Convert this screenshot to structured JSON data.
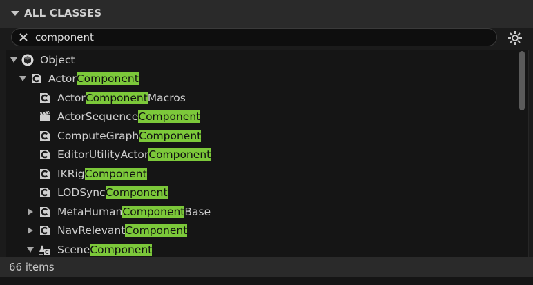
{
  "header": {
    "title": "ALL CLASSES"
  },
  "search": {
    "value": "component"
  },
  "tree": {
    "root": {
      "label": "Object"
    },
    "rows": [
      {
        "pre": "Actor",
        "hl": "Component",
        "post": ""
      },
      {
        "pre": "Actor",
        "hl": "Component",
        "post": "Macros"
      },
      {
        "pre": "ActorSequence",
        "hl": "Component",
        "post": ""
      },
      {
        "pre": "ComputeGraph",
        "hl": "Component",
        "post": ""
      },
      {
        "pre": "EditorUtilityActor",
        "hl": "Component",
        "post": ""
      },
      {
        "pre": "IKRig",
        "hl": "Component",
        "post": ""
      },
      {
        "pre": "LODSync",
        "hl": "Component",
        "post": ""
      },
      {
        "pre": "MetaHuman",
        "hl": "Component",
        "post": "Base"
      },
      {
        "pre": "NavRelevant",
        "hl": "Component",
        "post": ""
      },
      {
        "pre": "Scene",
        "hl": "Component",
        "post": ""
      }
    ]
  },
  "footer": {
    "count": "66 items"
  },
  "icons": {
    "collapse": "caret-down-icon",
    "clear": "x-icon",
    "settings": "gear-icon",
    "root": "object-sphere-icon",
    "class": "class-c-icon"
  },
  "colors": {
    "highlight": "#7cc83a",
    "background": "#1b1b1b"
  }
}
